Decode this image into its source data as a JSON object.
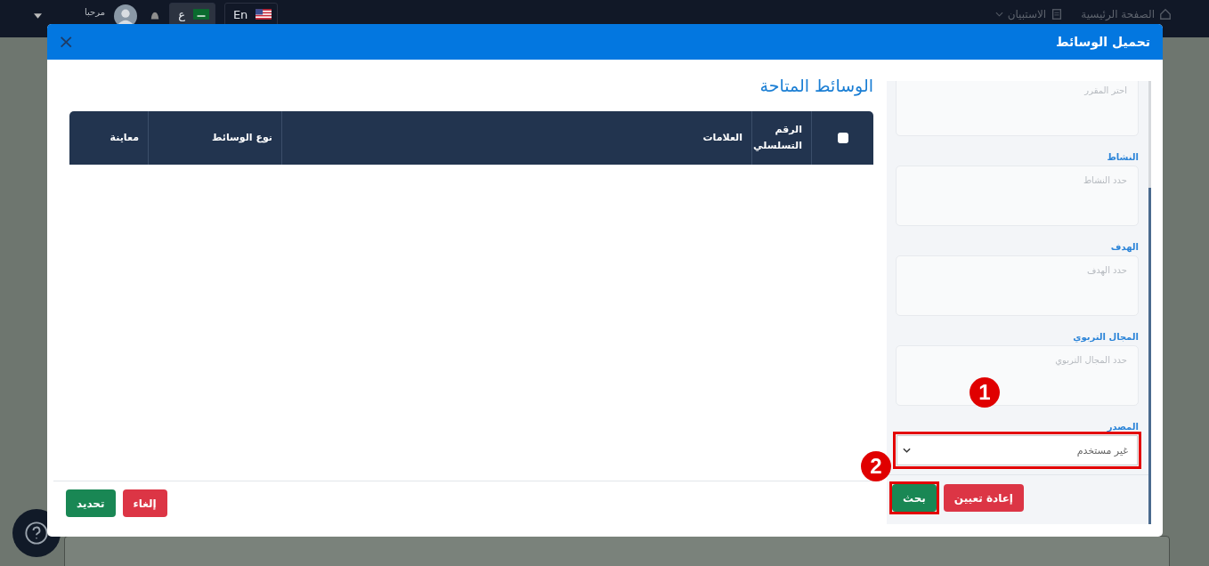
{
  "navbar": {
    "items": [
      {
        "label": "الصفحة الرئيسية",
        "kind": "home"
      },
      {
        "label": "الاستبيان",
        "kind": "survey"
      }
    ],
    "languages": [
      {
        "label": "En",
        "kind": "english",
        "selected": false
      },
      {
        "label": "ع",
        "kind": "arabic",
        "selected": true
      }
    ],
    "greeting": "مرحبا"
  },
  "modal": {
    "title": "تحميل الوسائط",
    "close": "×",
    "filters": [
      {
        "placeholder": "احتر المقرر"
      },
      {
        "label": "النشاط",
        "placeholder": "حدد النشاط"
      },
      {
        "label": "الهدف",
        "placeholder": "حدد الهدف"
      },
      {
        "label": "المجال التربوي",
        "placeholder": "حدد المجال التربوي"
      }
    ],
    "source": {
      "label": "المصدر",
      "value": "غير مستخدم",
      "highlighted": true
    },
    "filter_buttons": [
      {
        "label": "إعادة تعيين",
        "kind": "danger",
        "highlighted": false
      },
      {
        "label": "بحث",
        "kind": "success",
        "highlighted": true
      }
    ],
    "section_title": "الوسائط المتاحة",
    "table": {
      "select_all": {
        "checked": false
      },
      "columns": [
        "الرقم التسلسلي",
        "العلامات",
        "نوع الوسائط",
        "معاينة"
      ]
    },
    "footer_buttons": [
      {
        "label": "إلغاء",
        "kind": "danger"
      },
      {
        "label": "تحديد",
        "kind": "success"
      }
    ]
  },
  "annotations": [
    {
      "label": "1"
    },
    {
      "label": "2"
    }
  ]
}
